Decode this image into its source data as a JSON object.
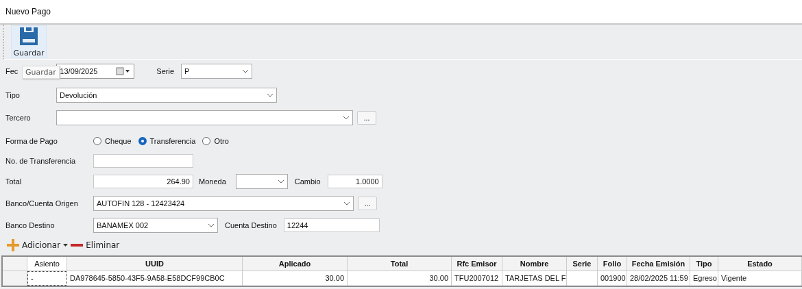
{
  "window": {
    "title": "Nuevo Pago"
  },
  "toolbar": {
    "buttons": [
      {
        "label": "Guardar"
      }
    ],
    "tooltip": "Guardar"
  },
  "form": {
    "fecha": {
      "label": "Fec",
      "value": "13/09/2025"
    },
    "serie": {
      "label": "Serie",
      "value": "P"
    },
    "tipo": {
      "label": "Tipo",
      "value": "Devolución"
    },
    "tercero": {
      "label": "Tercero",
      "browse": "..."
    },
    "forma_pago": {
      "label": "Forma de Pago",
      "options": [
        {
          "label": "Cheque",
          "selected": false
        },
        {
          "label": "Transferencia",
          "selected": true
        },
        {
          "label": "Otro",
          "selected": false
        }
      ]
    },
    "no_transferencia": {
      "label": "No. de Transferencia"
    },
    "total": {
      "label": "Total",
      "value": "264.90"
    },
    "moneda": {
      "label": "Moneda"
    },
    "cambio": {
      "label": "Cambio",
      "value": "1.0000"
    },
    "banco_origen": {
      "label": "Banco/Cuenta Origen",
      "value": "AUTOFIN 128 - 12423424",
      "browse": "..."
    },
    "banco_destino": {
      "label": "Banco Destino",
      "value": "BANAMEX 002"
    },
    "cuenta_destino": {
      "label": "Cuenta Destino",
      "value": "12244"
    }
  },
  "grid_toolbar": {
    "add": "Adicionar",
    "remove": "Eliminar"
  },
  "table": {
    "columns": [
      "Asiento",
      "UUID",
      "Aplicado",
      "Total",
      "Rfc Emisor",
      "Nombre",
      "Serie",
      "Folio",
      "Fecha Emisión",
      "Tipo",
      "Estado"
    ],
    "rows": [
      [
        "-",
        "DA978645-5850-43F5-9A58-E58DCF99CB0C",
        "30.00",
        "30.00",
        "TFU2007012",
        "TARJETAS DEL F",
        "",
        "001900",
        "28/02/2025 11:59",
        "Egreso",
        "Vigente"
      ]
    ]
  }
}
